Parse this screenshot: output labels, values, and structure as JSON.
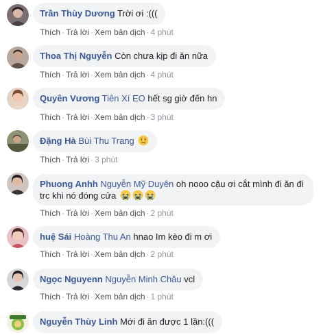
{
  "actions": {
    "like": "Thích",
    "reply": "Trả lời",
    "translate": "Xem bản dịch",
    "sep": "·"
  },
  "comments": [
    {
      "author": "Trần Thùy Dương",
      "mention": "",
      "text": "Trời ơi :(((",
      "time": "4 phút"
    },
    {
      "author": "Thoa Thị Nguyễn",
      "mention": "",
      "text": "Còn chưa kịp đi ăn nữa",
      "time": "4 phút"
    },
    {
      "author": "Quyên Vương",
      "mention": "Tiên Xí EO",
      "text": "hết sg giờ đến hn",
      "time": "3 phút"
    },
    {
      "author": "Đặng Hà",
      "mention": "Bùi Thu Trang",
      "text": "",
      "time": "3 phút"
    },
    {
      "author": "Phuong Anhh",
      "mention": "Nguyễn Mỹ Duyên",
      "text": "oh nooo cậu ơi cắt mình đi ăn đi",
      "text2": "trc khi nó đóng cửa",
      "time": "2 phút"
    },
    {
      "author": "huệ Sái",
      "mention": "Hoàng Thu An",
      "text": "hnao Im kèo đi m ơi",
      "time": "2 phút"
    },
    {
      "author": "Ngọc Nguyenn",
      "mention": "Nguyễn Minh Châu",
      "text": "vcl",
      "time": "1 phút"
    },
    {
      "author": "Nguyễn Thùy Linh",
      "mention": "",
      "text": "Mới đi ăn được 1 lần:(((",
      "time": ""
    }
  ],
  "colors": {
    "author": "#385898",
    "bubble": "#f2f3f5",
    "meta": "#90949c"
  },
  "icons": {
    "worried": "worried-face-emoji",
    "crying": "loudly-crying-face-emoji"
  }
}
